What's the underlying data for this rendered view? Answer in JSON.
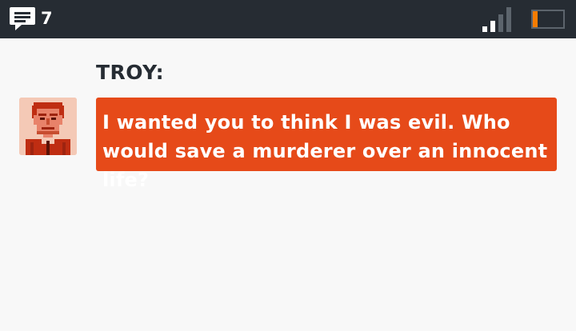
{
  "status_bar": {
    "unread_count": "7",
    "message_icon": "chat-bubble-icon",
    "signal_icon": "signal-strength-icon",
    "battery_icon": "battery-low-icon",
    "battery_level": 0.15,
    "colors": {
      "bar": "#262c33",
      "battery_fill": "#f57c00"
    }
  },
  "conversation": {
    "speaker": "TROY:",
    "avatar_icon": "troy-portrait-avatar",
    "message": "I wanted you to think I was evil. Who would save a murderer over an innocent life?",
    "colors": {
      "bubble": "#e64a19",
      "text": "#ffffff"
    }
  }
}
